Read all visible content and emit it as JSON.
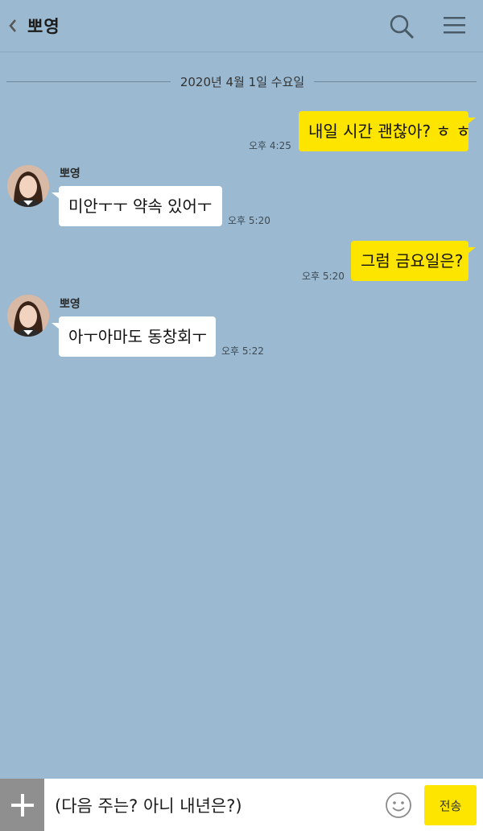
{
  "header": {
    "title": "뽀영",
    "back_icon": "chevron-left-icon",
    "search_icon": "search-icon",
    "menu_icon": "hamburger-menu-icon"
  },
  "date_divider": "2020년 4월 1일 수요일",
  "messages": [
    {
      "from": "me",
      "text": "내일 시간 괜찮아? ㅎ ㅎ",
      "time": "오후 4:25"
    },
    {
      "from": "them",
      "sender": "뽀영",
      "text": "미안ㅜㅜ 약속 있어ㅜ",
      "time": "오후 5:20"
    },
    {
      "from": "me",
      "text": "그럼 금요일은?",
      "time": "오후 5:20"
    },
    {
      "from": "them",
      "sender": "뽀영",
      "text": "아ㅜ아마도 동창회ㅜ",
      "time": "오후 5:22"
    }
  ],
  "input": {
    "value": "(다음 주는? 아니 내년은?)",
    "send_label": "전송",
    "plus_icon": "plus-icon",
    "emoji_icon": "emoticon-icon"
  },
  "colors": {
    "background": "#9bbad1",
    "my_bubble": "#fee500",
    "their_bubble": "#ffffff",
    "send_button": "#fee500"
  }
}
